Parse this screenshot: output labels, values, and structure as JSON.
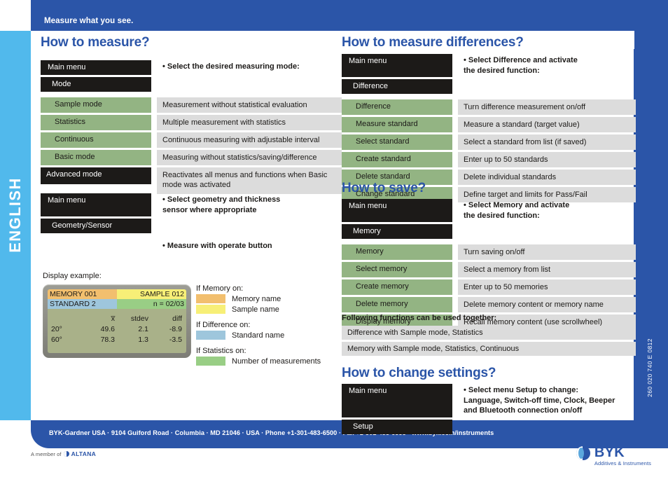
{
  "header": {
    "tagline": "Measure what you see."
  },
  "sidebar": {
    "language": "ENGLISH"
  },
  "right_edge": {
    "doc_code": "260 020 740 E 0812"
  },
  "sections": {
    "measure": {
      "title": "How to measure?",
      "note": "• Select the desired measuring mode:",
      "rows": [
        {
          "menu": "Main menu",
          "style": "dark",
          "desc": ""
        },
        {
          "menu": "Mode",
          "style": "dark-indent",
          "desc": ""
        },
        {
          "menu": "Sample mode",
          "style": "green",
          "desc": "Measurement without statistical evaluation"
        },
        {
          "menu": "Statistics",
          "style": "green",
          "desc": "Multiple measurement with statistics"
        },
        {
          "menu": "Continuous",
          "style": "green",
          "desc": "Continuous measuring with adjustable interval"
        },
        {
          "menu": "Basic mode",
          "style": "green",
          "desc": "Measuring without statistics/saving/difference"
        },
        {
          "menu": "Advanced mode",
          "style": "dark",
          "desc": "Reactivates all menus and functions when Basic mode was activated"
        }
      ]
    },
    "geometry": {
      "rows": [
        {
          "menu": "Main menu",
          "style": "dark"
        },
        {
          "menu": "Geometry/Sensor",
          "style": "dark-indent"
        }
      ],
      "note1": "• Select geometry and thickness\n   sensor where appropriate",
      "note2": "• Measure with operate button"
    },
    "display_example": {
      "caption": "Display example:",
      "lcd": {
        "memory_name": "MEMORY 001",
        "sample_name": "SAMPLE 012",
        "standard_name": "STANDARD 2",
        "count": "n = 02/03",
        "headers": {
          "geometry": "",
          "mean": "x̅",
          "stdev": "stdev",
          "diff": "diff"
        },
        "rows": [
          {
            "geometry": "20°",
            "mean": "49.6",
            "stdev": "2.1",
            "diff": "-8.9"
          },
          {
            "geometry": "60°",
            "mean": "78.3",
            "stdev": "1.3",
            "diff": "-3.5"
          }
        ]
      },
      "legend": [
        {
          "head": "If Memory on:",
          "items": [
            {
              "color": "#f2bf6e",
              "label": "Memory name"
            },
            {
              "color": "#f7ef77",
              "label": "Sample name"
            }
          ]
        },
        {
          "head": "If Difference on:",
          "items": [
            {
              "color": "#9ec6dc",
              "label": "Standard name"
            }
          ]
        },
        {
          "head": "If Statistics on:",
          "items": [
            {
              "color": "#99ce85",
              "label": "Number of measurements"
            }
          ]
        }
      ]
    },
    "differences": {
      "title": "How to measure differences?",
      "note": "• Select Difference and activate\n   the desired function:",
      "rows": [
        {
          "menu": "Main menu",
          "style": "dark",
          "desc": ""
        },
        {
          "menu": "Difference",
          "style": "dark-indent",
          "desc": ""
        },
        {
          "menu": "Difference",
          "style": "green",
          "desc": "Turn difference measurement on/off"
        },
        {
          "menu": "Measure standard",
          "style": "green",
          "desc": "Measure a standard (target value)"
        },
        {
          "menu": "Select standard",
          "style": "green",
          "desc": "Select a standard from list (if saved)"
        },
        {
          "menu": "Create standard",
          "style": "green",
          "desc": "Enter up to 50 standards"
        },
        {
          "menu": "Delete standard",
          "style": "green",
          "desc": "Delete individual standards"
        },
        {
          "menu": "Change standard",
          "style": "green",
          "desc": "Define target and limits for Pass/Fail"
        }
      ]
    },
    "save": {
      "title": "How to save?",
      "note": "• Select Memory and activate\n   the desired function:",
      "rows": [
        {
          "menu": "Main menu",
          "style": "dark",
          "desc": ""
        },
        {
          "menu": "Memory",
          "style": "dark-indent",
          "desc": ""
        },
        {
          "menu": "Memory",
          "style": "green",
          "desc": "Turn saving on/off"
        },
        {
          "menu": "Select memory",
          "style": "green",
          "desc": "Select a memory from list"
        },
        {
          "menu": "Create memory",
          "style": "green",
          "desc": "Enter up to 50 memories"
        },
        {
          "menu": "Delete memory",
          "style": "green",
          "desc": "Delete memory content or memory name"
        },
        {
          "menu": "Display memory",
          "style": "green",
          "desc": "Recall memory content (use scrollwheel)"
        }
      ]
    },
    "combinations": {
      "heading": "Following functions can be used together:",
      "items": [
        "Difference with Sample mode, Statistics",
        "Memory with Sample mode, Statistics, Continuous"
      ]
    },
    "settings": {
      "title": "How to change settings?",
      "rows": [
        {
          "menu": "Main menu",
          "style": "dark"
        },
        {
          "menu": "Setup",
          "style": "dark-indent"
        }
      ],
      "note": "• Select menu Setup to change:\nLanguage, Switch-off time, Clock, Beeper\nand Bluetooth connection on/off"
    }
  },
  "footer": {
    "address": "BYK-Gardner USA · 9104 Guiford Road · Columbia · MD 21046 · USA · Phone +1-301-483-6500 · Fax +1-301-483-6555 · www.byk.com/instruments",
    "member_of": "A member of",
    "altana": "ALTANA",
    "brand": "BYK",
    "brand_tagline": "Additives & Instruments"
  },
  "colors": {
    "brand_blue": "#2b55a8",
    "light_blue": "#51b9ec",
    "menu_dark": "#1c1a18",
    "menu_green": "#93b483",
    "desc_gray": "#dcdcdc",
    "lcd_bg": "#a9b189"
  }
}
